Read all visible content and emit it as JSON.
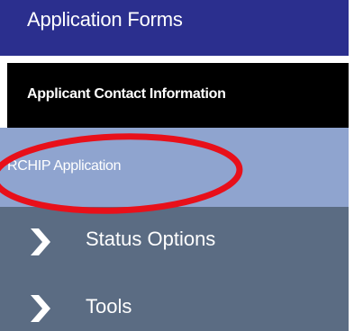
{
  "sidebar": {
    "header": "Application Forms",
    "items": [
      {
        "label": "Applicant Contact Information"
      },
      {
        "label": "RCHIP Application"
      },
      {
        "label": "Status Options",
        "icon": "chevron-right-icon"
      },
      {
        "label": "Tools",
        "icon": "chevron-right-icon"
      }
    ]
  },
  "colors": {
    "header_bg": "#2b2f8e",
    "active_item_bg": "#000000",
    "selected_item_bg": "#8fa4cf",
    "nav_bg": "#5b6c83",
    "annotation_stroke": "#e8101a"
  }
}
